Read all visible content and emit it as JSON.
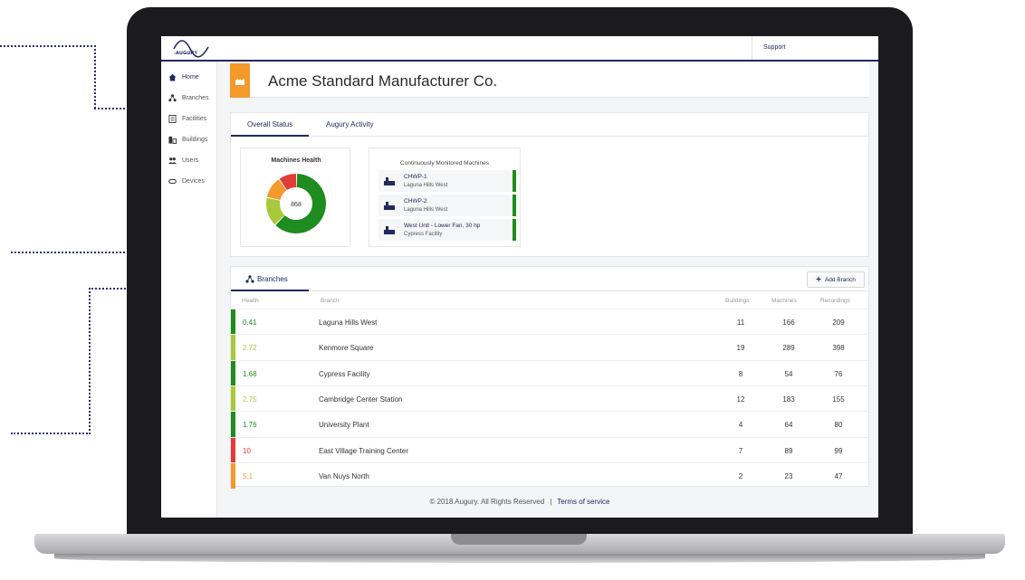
{
  "app": {
    "logo_text": "AUGURY",
    "support_label": "Support"
  },
  "sidebar": {
    "items": [
      {
        "label": "Home",
        "icon": "home-icon",
        "active": true
      },
      {
        "label": "Branches",
        "icon": "branches-icon",
        "active": false
      },
      {
        "label": "Facilities",
        "icon": "facilities-icon",
        "active": false
      },
      {
        "label": "Buildings",
        "icon": "buildings-icon",
        "active": false
      },
      {
        "label": "Users",
        "icon": "users-icon",
        "active": false
      },
      {
        "label": "Devices",
        "icon": "devices-icon",
        "active": false
      }
    ]
  },
  "header": {
    "company": "Acme Standard Manufacturer Co.",
    "badge_icon": "factory-icon"
  },
  "tabs": [
    {
      "label": "Overall Status",
      "active": true
    },
    {
      "label": "Augury Activity",
      "active": false
    }
  ],
  "health": {
    "title": "Machines Health",
    "center_value": "868",
    "segments": [
      {
        "color": "#1e8c1e",
        "fraction": 0.62
      },
      {
        "color": "#a8c93a",
        "fraction": 0.16
      },
      {
        "color": "#f39a2b",
        "fraction": 0.12
      },
      {
        "color": "#e53a3a",
        "fraction": 0.1
      }
    ]
  },
  "monitored": {
    "title": "Continuously Monitored Machines",
    "machines": [
      {
        "name": "CHWP-1",
        "location": "Laguna Hills West",
        "status_color": "#1e8c1e"
      },
      {
        "name": "CHWP-2",
        "location": "Laguna Hills West",
        "status_color": "#1e8c1e"
      },
      {
        "name": "West Unit - Lower Fan, 30 hp",
        "location": "Cypress Facility",
        "status_color": "#1e8c1e"
      }
    ]
  },
  "branches": {
    "tab_label": "Branches",
    "add_label": "Add Branch",
    "columns": {
      "health": "Health",
      "branch": "Branch",
      "buildings": "Buildings",
      "machines": "Machines",
      "recordings": "Recordings"
    },
    "rows": [
      {
        "health": "0.41",
        "branch": "Laguna Hills West",
        "buildings": "11",
        "machines": "166",
        "recordings": "209",
        "color": "#1e8c1e"
      },
      {
        "health": "2.72",
        "branch": "Kenmore Square",
        "buildings": "19",
        "machines": "289",
        "recordings": "398",
        "color": "#a8c93a"
      },
      {
        "health": "1.68",
        "branch": "Cypress Facility",
        "buildings": "8",
        "machines": "54",
        "recordings": "76",
        "color": "#1e8c1e"
      },
      {
        "health": "2.75",
        "branch": "Cambridge Center Station",
        "buildings": "12",
        "machines": "183",
        "recordings": "155",
        "color": "#a8c93a"
      },
      {
        "health": "1.76",
        "branch": "University Plant",
        "buildings": "4",
        "machines": "64",
        "recordings": "80",
        "color": "#1e8c1e"
      },
      {
        "health": "10",
        "branch": "East Village Training Center",
        "buildings": "7",
        "machines": "89",
        "recordings": "99",
        "color": "#e53a3a"
      },
      {
        "health": "5.1",
        "branch": "Van Nuys North",
        "buildings": "2",
        "machines": "23",
        "recordings": "47",
        "color": "#f39a2b"
      }
    ]
  },
  "footer": {
    "copyright": "© 2018 Augury. All Rights Reserved",
    "separator": "|",
    "terms": "Terms of service"
  }
}
